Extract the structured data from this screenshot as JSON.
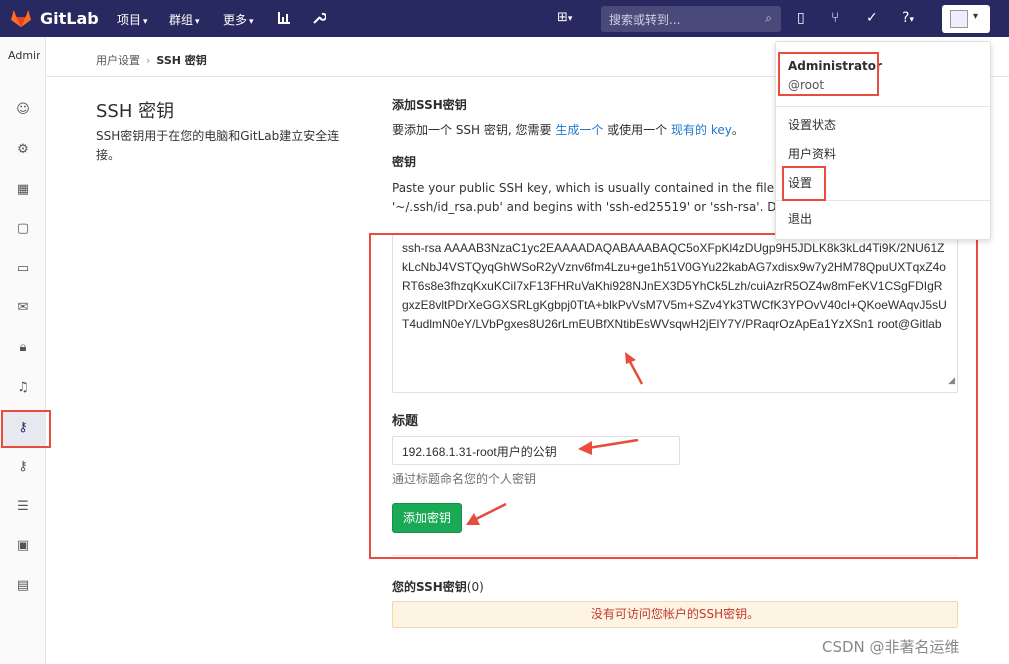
{
  "navbar": {
    "brand": "GitLab",
    "menus": [
      {
        "label": "项目"
      },
      {
        "label": "群组"
      },
      {
        "label": "更多"
      }
    ],
    "search_placeholder": "搜索或转到..."
  },
  "sidebar": {
    "avatar_alt": "Admin"
  },
  "breadcrumb": {
    "parent": "用户设置",
    "current": "SSH 密钥"
  },
  "page": {
    "title": "SSH 密钥",
    "description": "SSH密钥用于在您的电脑和GitLab建立安全连接。"
  },
  "add_section": {
    "title": "添加SSH密钥",
    "help_prefix": "要添加一个 SSH 密钥, 您需要 ",
    "link_generate": "生成一个",
    "help_middle": " 或使用一个 ",
    "link_existing": "现有的 key",
    "help_suffix": "。"
  },
  "key_section": {
    "label": "密钥",
    "hint_line1": "Paste your public SSH key, which is usually contained in the file '~/.ss",
    "hint_line2": "'~/.ssh/id_rsa.pub' and begins with 'ssh-ed25519' or 'ssh-rsa'. Don't u",
    "key_value": "ssh-rsa AAAAB3NzaC1yc2EAAAADAQABAAABAQC5oXFpKl4zDUgp9H5JDLK8k3kLd4Ti9K/2NU61ZkLcNbJ4VSTQyqGhWSoR2yVznv6fm4Lzu+ge1h51V0GYu22kabAG7xdisx9w7y2HM78QpuUXTqxZ4oRT6s8e3fhzqKxuKCiI7xF13FHRuVaKhi928NJnEX3D5YhCk5Lzh/cuiAzrR5OZ4w8mFeKV1CSgFDIgRgxzE8vltPDrXeGGXSRLgKgbpj0TtA+blkPvVsM7V5m+SZv4Yk3TWCfK3YPOvV40cI+QKoeWAqvJ5sUT4udlmN0eY/LVbPgxes8U26rLmEUBfXNtibEsWVsqwH2jElY7Y/PRaqrOzApEa1YzXSn1 root@Gitlab"
  },
  "title_section": {
    "label": "标题",
    "value": "192.168.1.31-root用户的公钥",
    "help": "通过标题命名您的个人密钥"
  },
  "add_button": "添加密钥",
  "keys_list": {
    "title": "您的SSH密钥",
    "count": "(0)",
    "empty": "没有可访问您帐户的SSH密钥。"
  },
  "dropdown": {
    "name": "Administrator",
    "handle": "@root",
    "items": [
      "设置状态",
      "用户资料",
      "设置",
      "退出"
    ]
  },
  "watermark": "CSDN @非著名运维",
  "colors": {
    "navbar": "#292961",
    "annotation": "#e74c3c",
    "button": "#1aaa55",
    "link": "#1f78d1"
  }
}
